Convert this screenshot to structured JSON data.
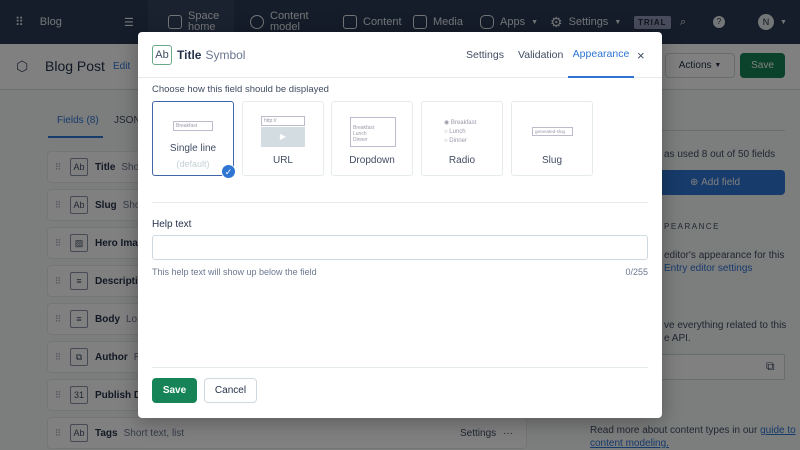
{
  "topnav": {
    "space": "Blog",
    "items": [
      "Space home",
      "Content model",
      "Content",
      "Media",
      "Apps",
      "Settings"
    ],
    "trial": "TRIAL",
    "avatar": "N"
  },
  "page": {
    "title": "Blog Post",
    "edit": "Edit",
    "actions": "Actions",
    "save": "Save"
  },
  "tabs": [
    "Fields (8)",
    "JSON"
  ],
  "fields": [
    {
      "name": "Title",
      "type": "Short",
      "icon": "Ab"
    },
    {
      "name": "Slug",
      "type": "Short",
      "icon": "Ab"
    },
    {
      "name": "Hero Image",
      "type": "",
      "icon": "▨"
    },
    {
      "name": "Description",
      "type": "",
      "icon": "≡"
    },
    {
      "name": "Body",
      "type": "Lo",
      "icon": "≡"
    },
    {
      "name": "Author",
      "type": "R",
      "icon": "⧉"
    },
    {
      "name": "Publish Date",
      "type": "",
      "icon": "31"
    },
    {
      "name": "Tags",
      "type": "Short text, list",
      "icon": "Ab",
      "settings": "Settings",
      "more": "···"
    }
  ],
  "sidebar": {
    "usage": "as used 8 out of 50 fields",
    "add_field": "Add field",
    "appearance": "PEARANCE",
    "appearance_text": "editor's appearance for this",
    "entry_link": "Entry editor settings",
    "api_text": "ve everything related to this",
    "api_text2": "e API.",
    "footer": "Read more about content types in our",
    "guide_link": "guide to",
    "guide_link2": "content modeling."
  },
  "modal": {
    "title": "Title",
    "type": "Symbol",
    "icon": "Ab",
    "tabs": [
      "Settings",
      "Validation",
      "Appearance"
    ],
    "active_tab": "Appearance",
    "prompt": "Choose how this field should be displayed",
    "widgets": [
      {
        "label": "Single line",
        "sub": "(default)",
        "preview": "Breakfast"
      },
      {
        "label": "URL",
        "preview": "http://"
      },
      {
        "label": "Dropdown",
        "options": [
          "Breakfast",
          "Lunch",
          "Dinner"
        ]
      },
      {
        "label": "Radio",
        "options": [
          "Breakfast",
          "Lunch",
          "Dinner"
        ]
      },
      {
        "label": "Slug",
        "preview": "generated-slug"
      }
    ],
    "help_label": "Help text",
    "help_value": "",
    "help_hint": "This help text will show up below the field",
    "counter": "0/255",
    "save": "Save",
    "cancel": "Cancel"
  },
  "colors": {
    "primary": "#2e75d4",
    "save": "#168457",
    "nav": "#1b273a"
  }
}
